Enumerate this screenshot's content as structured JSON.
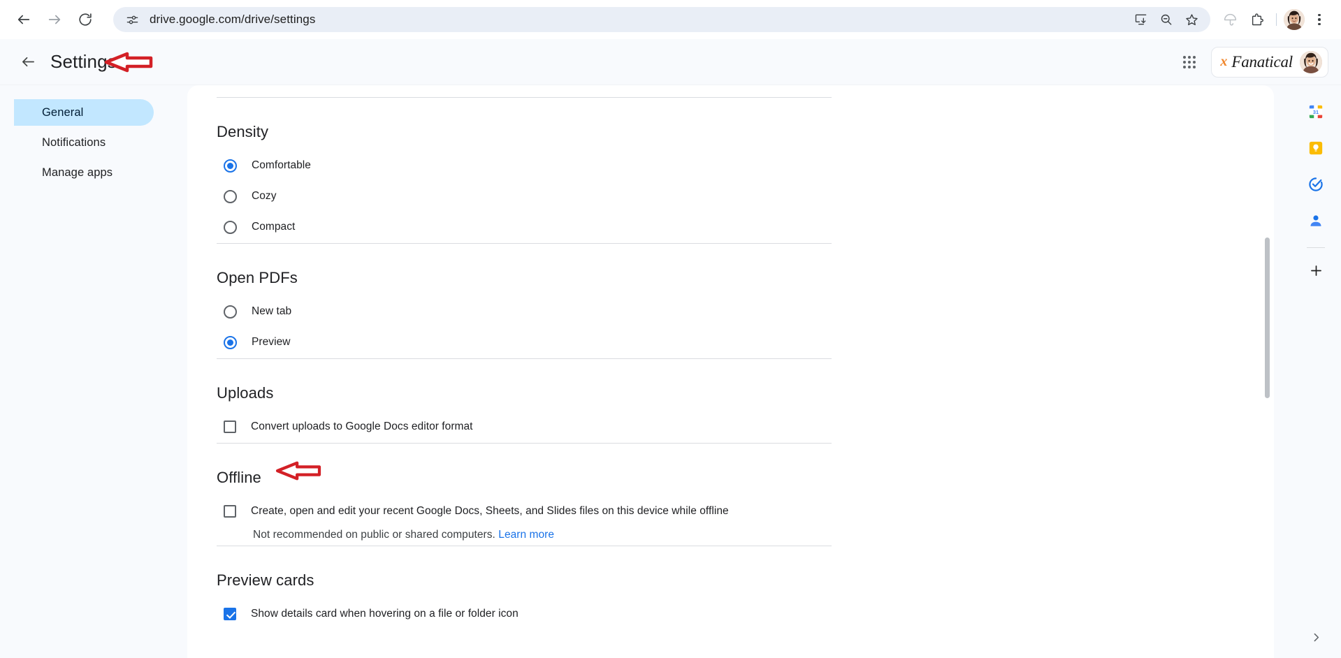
{
  "browser": {
    "url": "drive.google.com/drive/settings",
    "back_icon": "back-arrow-icon",
    "forward_icon": "forward-arrow-icon",
    "reload_icon": "reload-icon",
    "site_info_icon": "site-settings-icon",
    "install_icon": "install-app-icon",
    "zoom_icon": "zoom-out-icon",
    "bookmark_icon": "bookmark-star-icon",
    "umbrella_icon": "umbrella-icon",
    "extensions_icon": "extensions-puzzle-icon",
    "profile_icon": "profile-avatar",
    "menu_icon": "chrome-menu-icon"
  },
  "app_header": {
    "back_label": "back",
    "title": "Settings",
    "apps_label": "Google apps",
    "brand_prefix": "x",
    "brand_name": "Fanatical"
  },
  "sidebar": {
    "items": [
      {
        "label": "General",
        "active": true
      },
      {
        "label": "Notifications",
        "active": false
      },
      {
        "label": "Manage apps",
        "active": false
      }
    ]
  },
  "settings": {
    "sections": [
      {
        "id": "density",
        "title": "Density",
        "type": "radio",
        "options": [
          {
            "label": "Comfortable",
            "selected": true
          },
          {
            "label": "Cozy",
            "selected": false
          },
          {
            "label": "Compact",
            "selected": false
          }
        ]
      },
      {
        "id": "open-pdfs",
        "title": "Open PDFs",
        "type": "radio",
        "options": [
          {
            "label": "New tab",
            "selected": false
          },
          {
            "label": "Preview",
            "selected": true
          }
        ]
      },
      {
        "id": "uploads",
        "title": "Uploads",
        "type": "checkbox",
        "options": [
          {
            "label": "Convert uploads to Google Docs editor format",
            "checked": false
          }
        ]
      },
      {
        "id": "offline",
        "title": "Offline",
        "type": "checkbox",
        "options": [
          {
            "label": "Create, open and edit your recent Google Docs, Sheets, and Slides files on this device while offline",
            "checked": false
          }
        ],
        "sub_text": "Not recommended on public or shared computers.",
        "sub_link": "Learn more"
      },
      {
        "id": "preview-cards",
        "title": "Preview cards",
        "type": "checkbox",
        "options": [
          {
            "label": "Show details card when hovering on a file or folder icon",
            "checked": true
          }
        ]
      }
    ]
  },
  "side_panel": {
    "items": [
      {
        "name": "google-calendar-icon",
        "label": "Calendar",
        "day": "31"
      },
      {
        "name": "google-keep-icon",
        "label": "Keep"
      },
      {
        "name": "google-tasks-icon",
        "label": "Tasks"
      },
      {
        "name": "google-contacts-icon",
        "label": "Contacts"
      },
      {
        "name": "add-app-icon",
        "label": "Get add-ons"
      }
    ],
    "expand_label": "Show side panel"
  },
  "annotations": {
    "arrow_color": "#d32026",
    "arrow_settings_target": "Settings",
    "arrow_offline_target": "Offline"
  },
  "colors": {
    "accent_blue": "#1a73e8",
    "nav_active_bg": "#c2e7ff",
    "page_bg": "#f8fafd",
    "card_bg": "#ffffff",
    "divider": "#dadce0",
    "brand_orange": "#f0862b"
  }
}
